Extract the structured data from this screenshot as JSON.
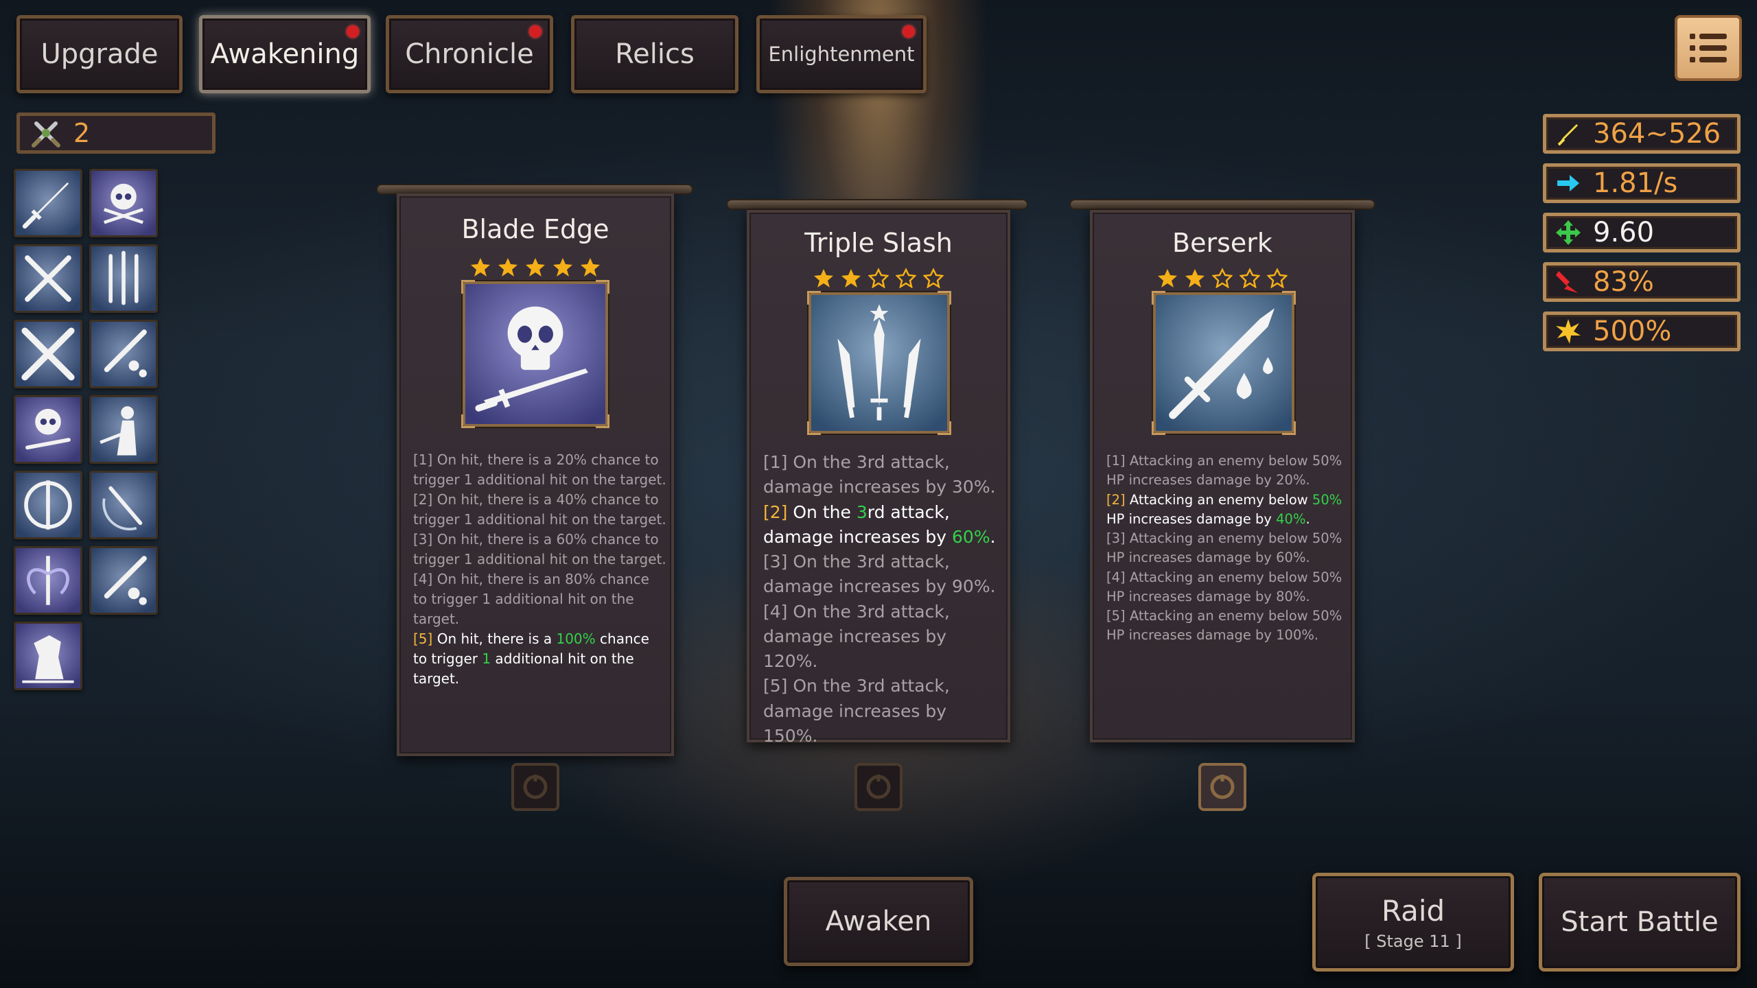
{
  "tabs": [
    {
      "label": "Upgrade",
      "active": false,
      "badge": false
    },
    {
      "label": "Awakening",
      "active": true,
      "badge": true
    },
    {
      "label": "Chronicle",
      "active": false,
      "badge": true
    },
    {
      "label": "Relics",
      "active": false,
      "badge": false
    },
    {
      "label": "Enlightenment",
      "active": false,
      "badge": true
    }
  ],
  "counter": {
    "value": "2"
  },
  "stats": [
    {
      "icon": "attack-sword-icon",
      "value": "364~526"
    },
    {
      "icon": "speed-arrow-icon",
      "value": "1.81/s"
    },
    {
      "icon": "move-cross-icon",
      "value": "9.60"
    },
    {
      "icon": "crit-chance-icon",
      "value": "83%"
    },
    {
      "icon": "crit-damage-icon",
      "value": "500%"
    }
  ],
  "cards": [
    {
      "title": "Blade Edge",
      "stars": 5,
      "lines": [
        {
          "tag": "[1]",
          "text": "On hit, there is a 20% chance to trigger 1 additional hit on the target."
        },
        {
          "tag": "[2]",
          "text": "On hit, there is a 40% chance to trigger 1 additional hit on the target."
        },
        {
          "tag": "[3]",
          "text": "On hit, there is a 60% chance to trigger 1 additional hit on the target."
        },
        {
          "tag": "[4]",
          "text": "On hit, there is an 80% chance to trigger 1 additional hit on the target."
        },
        {
          "tag": "[5]",
          "pre": "On hit, there is a ",
          "val1": "100%",
          "mid": " chance to trigger ",
          "val2": "1",
          "post": " additional hit on the target."
        }
      ]
    },
    {
      "title": "Triple Slash",
      "stars": 2,
      "lines": [
        {
          "tag": "[1]",
          "text": "On the 3rd attack, damage increases by 30%."
        },
        {
          "tag": "[2]",
          "pre": "On the ",
          "val1": "3",
          "mid": "rd attack, damage increases by ",
          "val2": "60%",
          "post": "."
        },
        {
          "tag": "[3]",
          "text": "On the 3rd attack, damage increases by 90%."
        },
        {
          "tag": "[4]",
          "text": "On the 3rd attack, damage increases by 120%."
        },
        {
          "tag": "[5]",
          "text": "On the 3rd attack, damage increases by 150%."
        }
      ]
    },
    {
      "title": "Berserk",
      "stars": 2,
      "lines": [
        {
          "tag": "[1]",
          "text": "Attacking an enemy below 50% HP increases damage by 20%."
        },
        {
          "tag": "[2]",
          "pre": "Attacking an enemy below ",
          "val1": "50%",
          "mid": " HP increases damage by ",
          "val2": "40%",
          "post": "."
        },
        {
          "tag": "[3]",
          "text": "Attacking an enemy below 50% HP increases damage by 60%."
        },
        {
          "tag": "[4]",
          "text": "Attacking an enemy below 50% HP increases damage by 80%."
        },
        {
          "tag": "[5]",
          "text": "Attacking an enemy below 50% HP increases damage by 100%."
        }
      ]
    }
  ],
  "buttons": {
    "awaken": "Awaken",
    "raid": "Raid",
    "raid_stage": "[ Stage 11 ]",
    "start_battle": "Start Battle"
  },
  "colors": {
    "accent_orange": "#f0a246",
    "highlight_yellow": "#f4b63a",
    "highlight_green": "#34d14a",
    "badge_red": "#d41f22",
    "frame_gold": "#b38a58"
  }
}
